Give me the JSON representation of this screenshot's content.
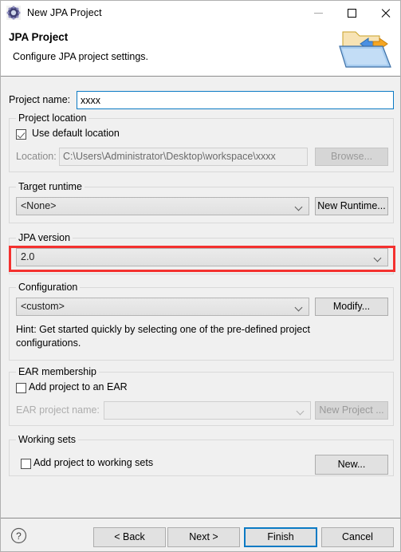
{
  "window": {
    "title": "New JPA Project",
    "icon": "jpa-project-gear-icon",
    "controls": {
      "minimize": "minimize-icon",
      "maximize": "maximize-icon",
      "close": "close-icon"
    }
  },
  "header": {
    "title": "JPA Project",
    "subtitle": "Configure JPA project settings.",
    "art_icon": "folder-import-export-icon"
  },
  "form": {
    "project_name": {
      "label": "Project name:",
      "value": "xxxx",
      "placeholder": ""
    },
    "project_location": {
      "group_label": "Project location",
      "use_default_label": "Use default location",
      "use_default_checked": true,
      "location_label": "Location:",
      "location_value": "C:\\Users\\Administrator\\Desktop\\workspace\\xxxx",
      "browse_label": "Browse..."
    },
    "target_runtime": {
      "group_label": "Target runtime",
      "selected": "<None>",
      "new_runtime_label": "New Runtime..."
    },
    "jpa_version": {
      "group_label": "JPA version",
      "selected": "2.0",
      "highlight_color": "#f4312f"
    },
    "configuration": {
      "group_label": "Configuration",
      "selected": "<custom>",
      "modify_label": "Modify...",
      "hint": "Hint: Get started quickly by selecting one of the pre-defined project configurations."
    },
    "ear_membership": {
      "group_label": "EAR membership",
      "add_to_ear_label": "Add project to an EAR",
      "add_to_ear_checked": false,
      "ear_project_name_label": "EAR project name:",
      "ear_project_name_value": "",
      "new_project_label": "New Project ..."
    },
    "working_sets": {
      "group_label": "Working sets",
      "add_to_working_sets_label": "Add project to working sets",
      "add_to_working_sets_checked": false,
      "new_label": "New..."
    }
  },
  "footer": {
    "help_icon": "help-question-icon",
    "back_label": "< Back",
    "next_label": "Next >",
    "finish_label": "Finish",
    "cancel_label": "Cancel",
    "focus_color": "#0b7ac4"
  }
}
